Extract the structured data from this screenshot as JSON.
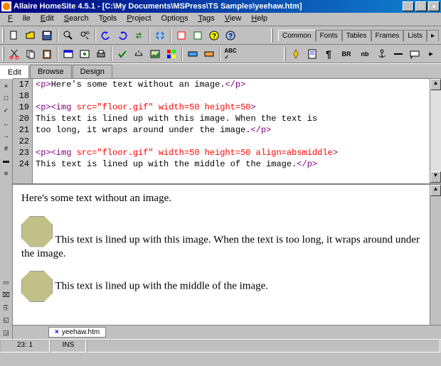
{
  "window": {
    "title": "Allaire HomeSite 4.5.1 - [C:\\My Documents\\MSPress\\TS Samples\\yeehaw.htm]"
  },
  "menu": {
    "file": "File",
    "edit": "Edit",
    "search": "Search",
    "tools": "Tools",
    "project": "Project",
    "options": "Options",
    "tags": "Tags",
    "view": "View",
    "help": "Help"
  },
  "right_tabs": {
    "common": "Common",
    "fonts": "Fonts",
    "tables": "Tables",
    "frames": "Frames",
    "lists": "Lists"
  },
  "tag_buttons": {
    "p": "¶",
    "br": "BR",
    "nb": "nb"
  },
  "mode_tabs": {
    "edit": "Edit",
    "browse": "Browse",
    "design": "Design"
  },
  "gutter": [
    "17",
    "18",
    "19",
    "20",
    "21",
    "22",
    "23",
    "24"
  ],
  "code": {
    "l17a": "<p>",
    "l17b": "Here's some text without an image.",
    "l17c": "</p>",
    "l18": "",
    "l19a": "<p><img ",
    "l19b": "src=",
    "l19c": "\"floor.gif\"",
    "l19d": " width=",
    "l19e": "50",
    "l19f": " height=",
    "l19g": "50",
    "l19h": ">",
    "l20": "This text is lined up with this image. When the text is",
    "l21a": "too long, it wraps around under the image.",
    "l21b": "</p>",
    "l22": "",
    "l23a": "<p><img ",
    "l23b": "src=",
    "l23c": "\"floor.gif\"",
    "l23d": " width=",
    "l23e": "50",
    "l23f": " height=",
    "l23g": "50",
    "l23h": " align=",
    "l23i": "absmiddle",
    "l23j": ">",
    "l24a": "This text is lined up with the middle of the image.",
    "l24b": "</p>"
  },
  "preview": {
    "p1": "Here's some text without an image.",
    "p2": "This text is lined up with this image. When the text is too long, it wraps around under the image.",
    "p3": "This text is lined up with the middle of the image."
  },
  "filetab": {
    "name": "yeehaw.htm"
  },
  "status": {
    "pos": "23: 1",
    "ins": "INS"
  },
  "left_icons": [
    "×",
    "□",
    "✓",
    "←",
    "→",
    "#",
    "▬",
    "≡"
  ],
  "left_icons2": [
    "▭",
    "⌧",
    "⎘",
    "◱",
    "◲"
  ]
}
